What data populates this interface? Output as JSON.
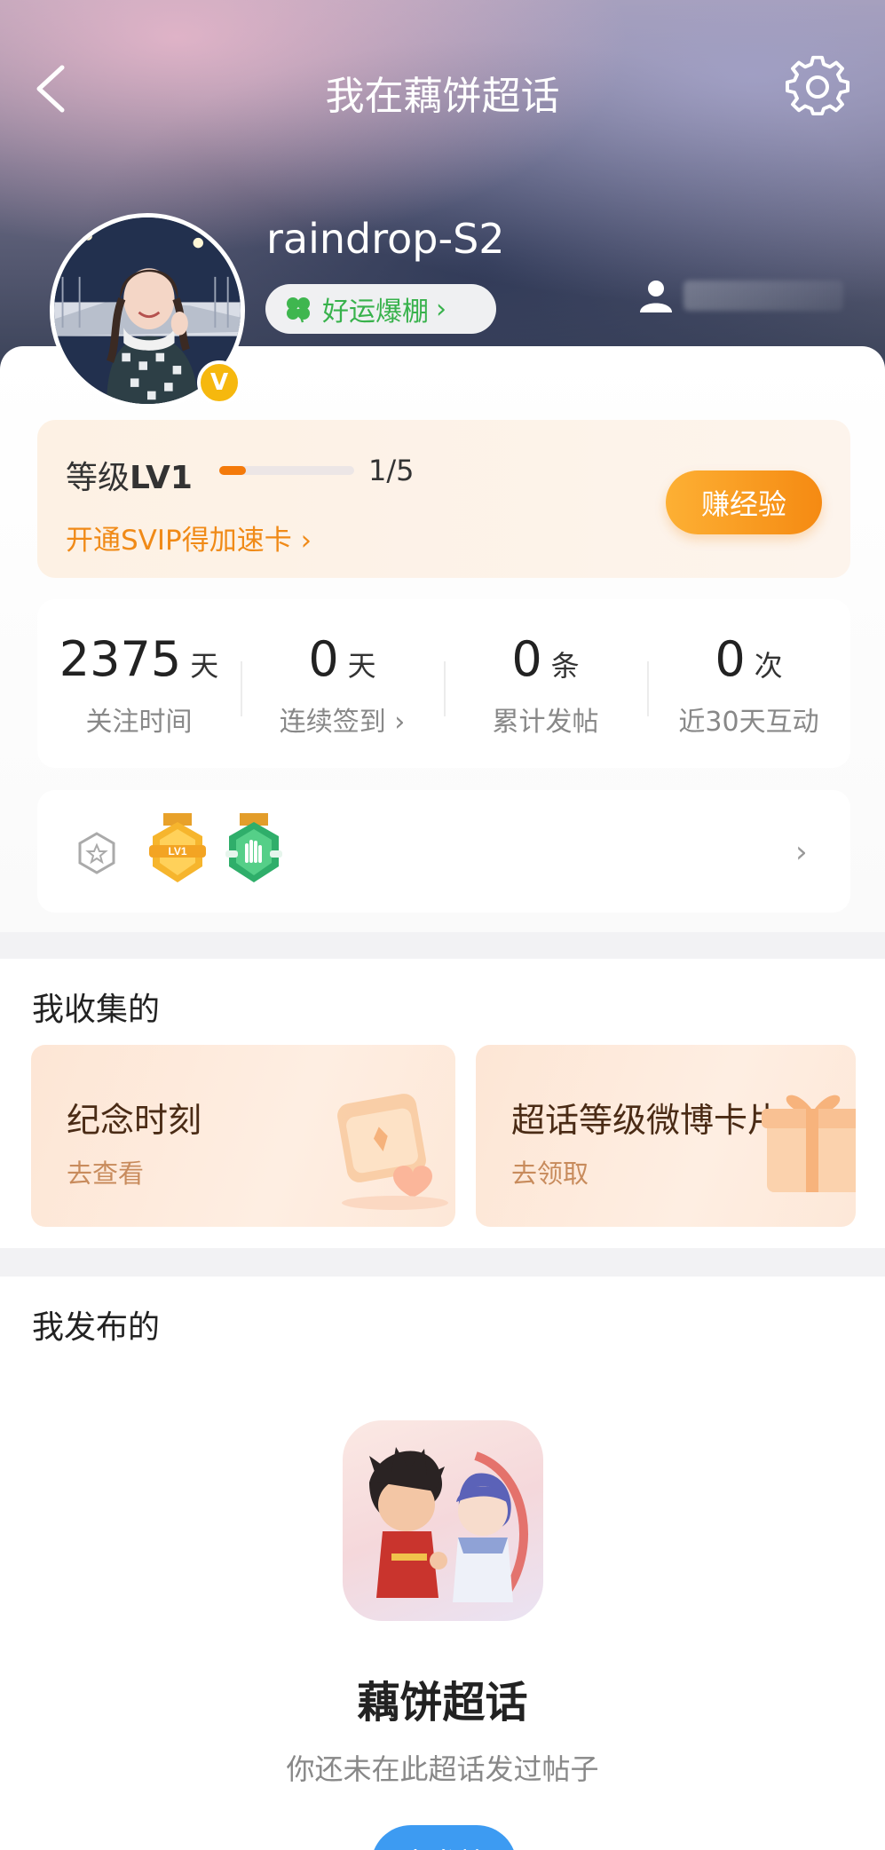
{
  "header": {
    "title": "我在藕饼超话",
    "username": "raindrop-S2",
    "luck_tag": "好运爆棚",
    "avatar_badge": "V"
  },
  "level": {
    "label_prefix": "等级",
    "label_level": "LV1",
    "progress_text": "1/5",
    "progress": 0.2,
    "svip_link": "开通SVIP得加速卡",
    "earn_button": "赚经验"
  },
  "stats": [
    {
      "value": "2375",
      "unit": "天",
      "caption": "关注时间"
    },
    {
      "value": "0",
      "unit": "天",
      "caption": "连续签到"
    },
    {
      "value": "0",
      "unit": "条",
      "caption": "累计发帖"
    },
    {
      "value": "0",
      "unit": "次",
      "caption": "近30天互动"
    }
  ],
  "badges": {
    "items": [
      {
        "name": "LV1",
        "color": "#f6b52d"
      },
      {
        "name": "interaction-badge",
        "color": "#3dbd74"
      }
    ]
  },
  "collections": {
    "title": "我收集的",
    "cards": [
      {
        "title": "纪念时刻",
        "subtitle": "去查看"
      },
      {
        "title": "超话等级微博卡片",
        "subtitle": "去领取"
      }
    ]
  },
  "posts": {
    "title": "我发布的",
    "topic_name": "藕饼超话",
    "empty_hint": "你还未在此超话发过帖子",
    "post_button": "去发帖"
  },
  "colors": {
    "accent_orange": "#f58a12",
    "luck_green": "#38b24c",
    "primary_blue": "#3d9bf2"
  }
}
